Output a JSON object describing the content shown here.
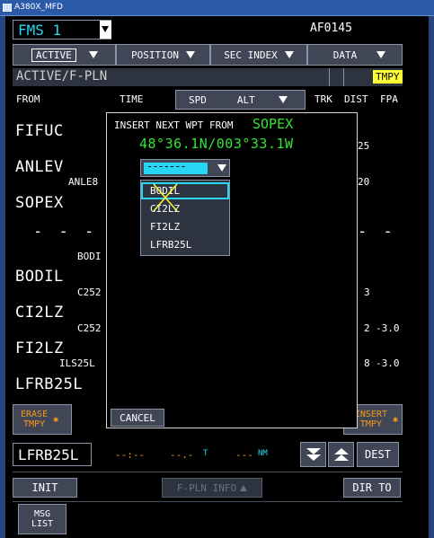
{
  "window": {
    "title": "A380X_MFD"
  },
  "header": {
    "fms_select": "FMS 1",
    "flight_number": "AF0145"
  },
  "menu": {
    "active": "ACTIVE",
    "position": "POSITION",
    "sec_index": "SEC INDEX",
    "data": "DATA"
  },
  "page": {
    "title": "ACTIVE/F-PLN",
    "tmpy_badge": "TMPY"
  },
  "columns": {
    "from": "FROM",
    "time": "TIME",
    "spd": "SPD",
    "alt": "ALT",
    "trk": "TRK",
    "dist": "DIST",
    "fpa": "FPA"
  },
  "flight_plan": [
    {
      "name": "FIFUC",
      "dist": "25",
      "fpa": ""
    },
    {
      "name": "ANLEV",
      "sub": "ANLE8",
      "dist": "20",
      "fpa": ""
    },
    {
      "name": "SOPEX",
      "dist": "",
      "fpa": ""
    },
    {
      "name": "- - - -",
      "dist": "- -",
      "fpa": ""
    },
    {
      "name": "BODIL",
      "sub_above": "BODI",
      "sub": "C252",
      "dist": "3",
      "fpa": ""
    },
    {
      "name": "CI2LZ",
      "sub": "C252",
      "dist": "2",
      "fpa": "-3.0"
    },
    {
      "name": "FI2LZ",
      "sub": "ILS25L",
      "dist": "8",
      "fpa": "-3.0"
    },
    {
      "name": "LFRB25L",
      "dist": "",
      "fpa": ""
    }
  ],
  "popup": {
    "title_prefix": "INSERT NEXT WPT FROM",
    "from_wpt": "SOPEX",
    "coords": "48°36.1N/003°33.1W",
    "input_value": "-------",
    "options": [
      "BODIL",
      "CI2LZ",
      "FI2LZ",
      "LFRB25L"
    ],
    "cancel_label": "CANCEL"
  },
  "bottom_buttons": {
    "erase_tmpy": "ERASE\nTMPY",
    "insert_tmpy": "INSERT\nTMPY"
  },
  "dest": {
    "name": "LFRB25L",
    "time": "--:--",
    "track": "--.-",
    "track_unit": "T",
    "dist": "---",
    "dist_unit": "NM",
    "dest_label": "DEST"
  },
  "footer": {
    "init": "INIT",
    "fpln_info": "F-PLN INFO",
    "dir_to": "DIR TO",
    "msg_list": "MSG\nLIST"
  }
}
